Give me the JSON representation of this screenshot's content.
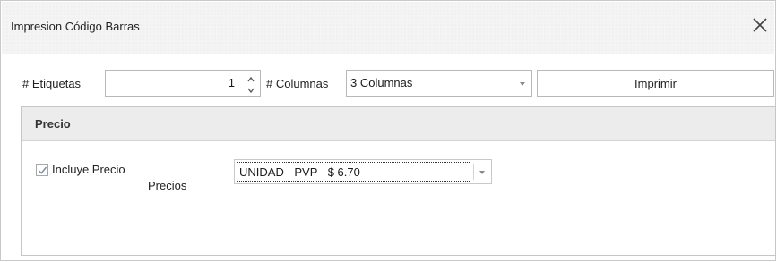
{
  "window": {
    "title": "Impresion Código Barras",
    "close_icon": "close-icon"
  },
  "toolbar": {
    "etiquetas_label": "# Etiquetas",
    "etiquetas_value": "1",
    "columnas_label": "# Columnas",
    "columnas_selected": "3 Columnas",
    "print_label": "Imprimir"
  },
  "precio_group": {
    "title": "Precio",
    "includes_price_label": "Incluye Precio",
    "includes_price_checked": true,
    "precios_label": "Precios",
    "precios_selected": "UNIDAD - PVP - $ 6.70"
  }
}
